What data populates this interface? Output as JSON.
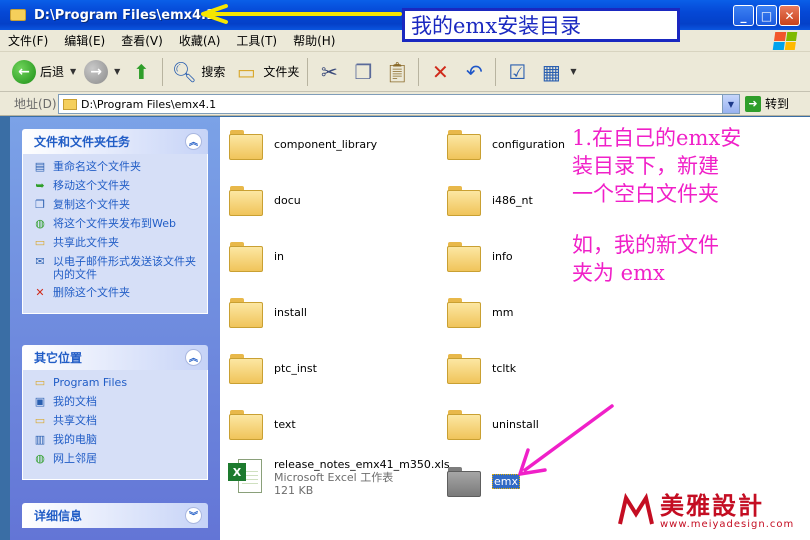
{
  "window": {
    "title": "D:\\Program Files\\emx4.1"
  },
  "menu": [
    "文件(F)",
    "编辑(E)",
    "查看(V)",
    "收藏(A)",
    "工具(T)",
    "帮助(H)"
  ],
  "toolbar": {
    "back_label": "后退",
    "search_label": "搜索",
    "folders_label": "文件夹"
  },
  "address": {
    "label": "地址(D)",
    "value": "D:\\Program Files\\emx4.1",
    "go_label": "转到"
  },
  "left_pane": {
    "tasks_title": "文件和文件夹任务",
    "tasks": [
      "重命名这个文件夹",
      "移动这个文件夹",
      "复制这个文件夹",
      "将这个文件夹发布到Web",
      "共享此文件夹",
      "以电子邮件形式发送该文件夹内的文件",
      "删除这个文件夹"
    ],
    "places_title": "其它位置",
    "places": [
      "Program Files",
      "我的文档",
      "共享文档",
      "我的电脑",
      "网上邻居"
    ],
    "details_title": "详细信息"
  },
  "files": [
    "component_library",
    "configuration",
    "docu",
    "i486_nt",
    "in",
    "info",
    "install",
    "mm",
    "ptc_inst",
    "tcltk",
    "text",
    "uninstall"
  ],
  "xls_file": {
    "name": "release_notes_emx41_m350.xls",
    "type": "Microsoft Excel 工作表",
    "size": "121 KB"
  },
  "new_folder": "emx",
  "annotations": {
    "box_text": "我的emx安装目录",
    "pink_line1": "1.在自己的emx安",
    "pink_line2": "装目录下，新建",
    "pink_line3": "一个空白文件夹",
    "pink_line4": "如，我的新文件",
    "pink_line5": "夹为 emx"
  },
  "watermark": {
    "title": "美雅設計",
    "url": "www.meiyadesign.com"
  },
  "colors": {
    "annotation_blue": "#1a28c0",
    "annotation_pink": "#f020c8",
    "titlebar_blue": "#0548d6",
    "annotation_arrow_yellow": "#f5e600"
  }
}
